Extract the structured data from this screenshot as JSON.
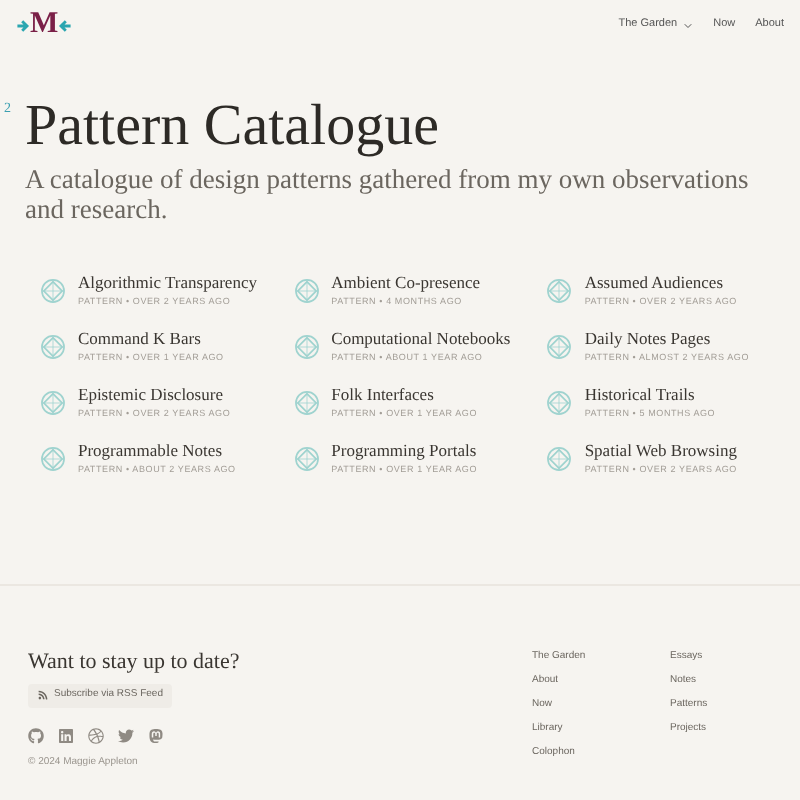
{
  "header": {
    "logo": "M",
    "nav": [
      {
        "label": "The Garden",
        "kind": "dropdown"
      },
      {
        "label": "Now",
        "kind": "link"
      },
      {
        "label": "About",
        "kind": "link"
      }
    ]
  },
  "heading": {
    "count": "2",
    "title": "Pattern Catalogue",
    "subtitle": "A catalogue of design patterns gathered from my own observations and research."
  },
  "patterns": [
    {
      "title": "Algorithmic Transparency",
      "meta": "PATTERN • OVER 2 YEARS AGO"
    },
    {
      "title": "Ambient Co-presence",
      "meta": "PATTERN • 4 MONTHS AGO"
    },
    {
      "title": "Assumed Audiences",
      "meta": "PATTERN • OVER 2 YEARS AGO"
    },
    {
      "title": "Command K Bars",
      "meta": "PATTERN • OVER 1 YEAR AGO"
    },
    {
      "title": "Computational Notebooks",
      "meta": "PATTERN • ABOUT 1 YEAR AGO"
    },
    {
      "title": "Daily Notes Pages",
      "meta": "PATTERN • ALMOST 2 YEARS AGO"
    },
    {
      "title": "Epistemic Disclosure",
      "meta": "PATTERN • OVER 2 YEARS AGO"
    },
    {
      "title": "Folk Interfaces",
      "meta": "PATTERN • OVER 1 YEAR AGO"
    },
    {
      "title": "Historical Trails",
      "meta": "PATTERN • 5 MONTHS AGO"
    },
    {
      "title": "Programmable Notes",
      "meta": "PATTERN • ABOUT 2 YEARS AGO"
    },
    {
      "title": "Programming Portals",
      "meta": "PATTERN • OVER 1 YEAR AGO"
    },
    {
      "title": "Spatial Web Browsing",
      "meta": "PATTERN • OVER 2 YEARS AGO"
    }
  ],
  "footer": {
    "heading": "Want to stay up to date?",
    "rss_button": "Subscribe via RSS Feed",
    "socials": [
      {
        "kind": "github"
      },
      {
        "kind": "linkedin"
      },
      {
        "kind": "dribbble"
      },
      {
        "kind": "twitter"
      },
      {
        "kind": "mastodon"
      }
    ],
    "copyright": "© 2024 Maggie Appleton",
    "link_columns": [
      [
        "The Garden",
        "About",
        "Now",
        "Library",
        "Colophon"
      ],
      [
        "Essays",
        "Notes",
        "Patterns",
        "Projects"
      ]
    ]
  }
}
